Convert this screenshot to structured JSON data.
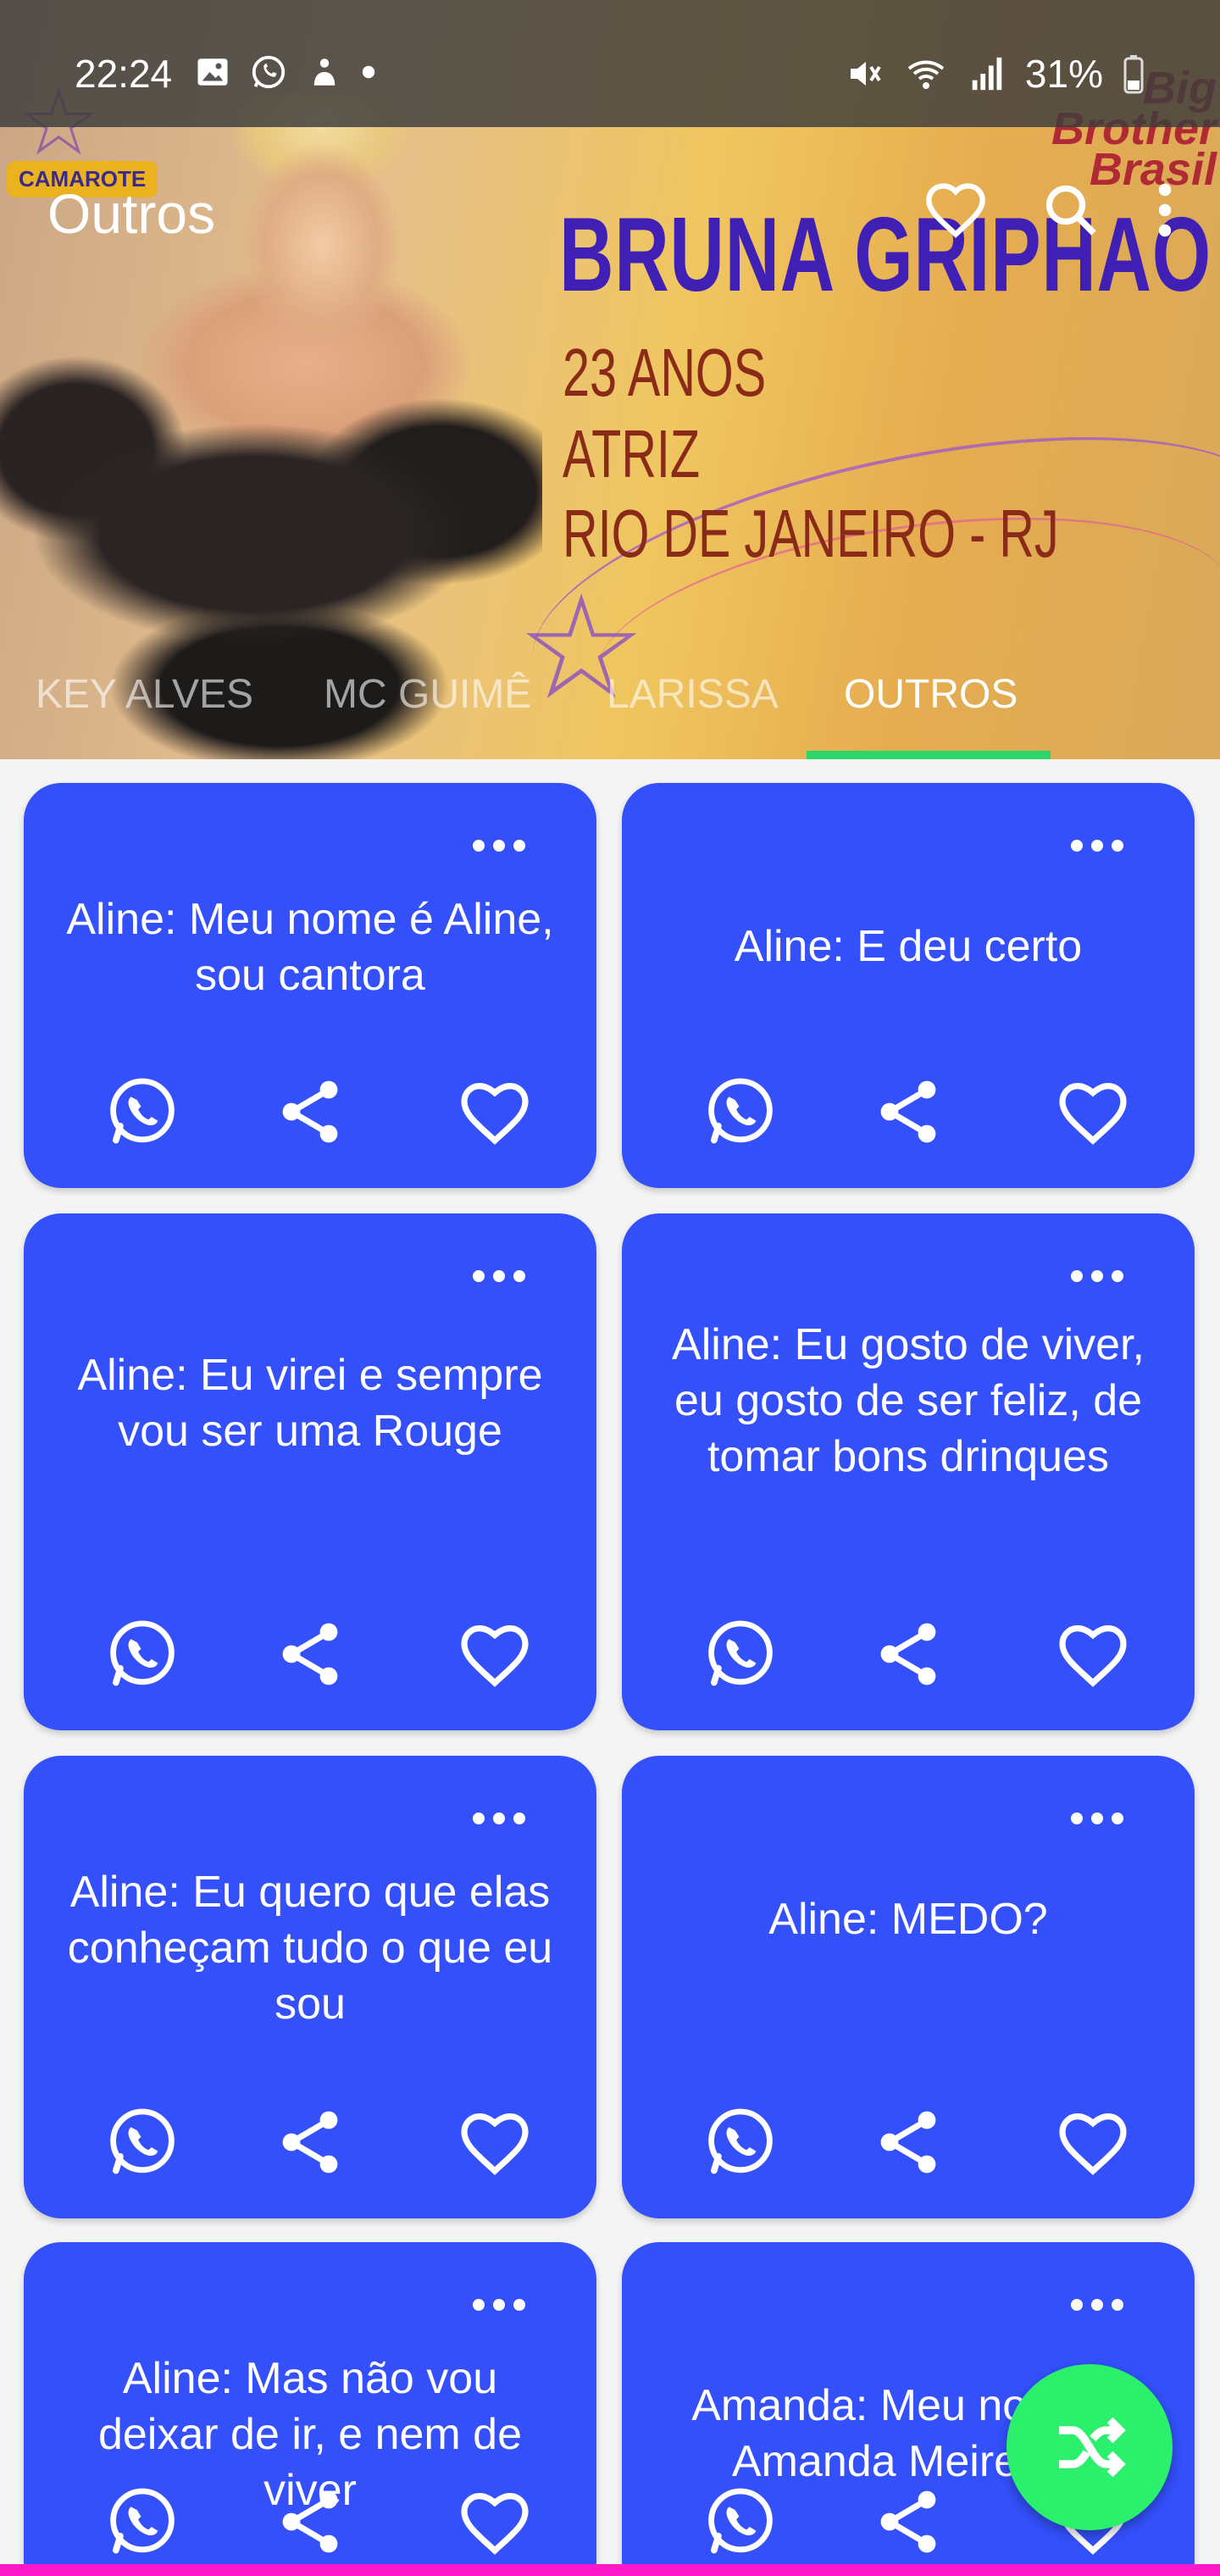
{
  "status_bar": {
    "time": "22:24",
    "battery": "31%",
    "left_icons": [
      "gallery-icon",
      "whatsapp-icon",
      "app-icon",
      "dot-icon"
    ],
    "right_icons": [
      "mute-icon",
      "wifi-icon",
      "signal-icon",
      "battery-icon"
    ]
  },
  "toolbar": {
    "title": "Outros",
    "actions": [
      "favorites-icon",
      "search-icon",
      "more-vert-icon"
    ]
  },
  "banner": {
    "name": "BRUNA GRIPHAO",
    "lines": [
      "23 ANOS",
      "ATRIZ",
      "RIO DE JANEIRO - RJ"
    ],
    "badge": "CAMAROTE",
    "logo": "Big Brother Brasil"
  },
  "tabs": [
    {
      "label": "KEY ALVES",
      "active": false
    },
    {
      "label": "MC GUIMÊ",
      "active": false
    },
    {
      "label": "LARISSA",
      "active": false
    },
    {
      "label": "OUTROS",
      "active": true
    }
  ],
  "cards": [
    {
      "text": "Aline: Meu nome é Aline, sou cantora"
    },
    {
      "text": "Aline: E deu certo"
    },
    {
      "text": "Aline: Eu virei e sempre vou ser uma Rouge"
    },
    {
      "text": "Aline: Eu gosto de viver, eu gosto de ser feliz, de tomar bons drinques"
    },
    {
      "text": "Aline: Eu quero que elas conheçam tudo o que eu sou"
    },
    {
      "text": "Aline: MEDO?"
    },
    {
      "text": "Aline: Mas não vou deixar de ir, e nem de viver"
    },
    {
      "text": "Amanda: Meu nome é Amanda Meirelles"
    }
  ],
  "card_actions": [
    "whatsapp-icon",
    "share-icon",
    "heart-icon"
  ],
  "fab": {
    "icon": "shuffle-icon"
  },
  "colors": {
    "card": "#3350fb",
    "fab": "#2bf06b",
    "tab_indicator": "#2bd56a",
    "bottom_strip": "#ff18c8"
  }
}
